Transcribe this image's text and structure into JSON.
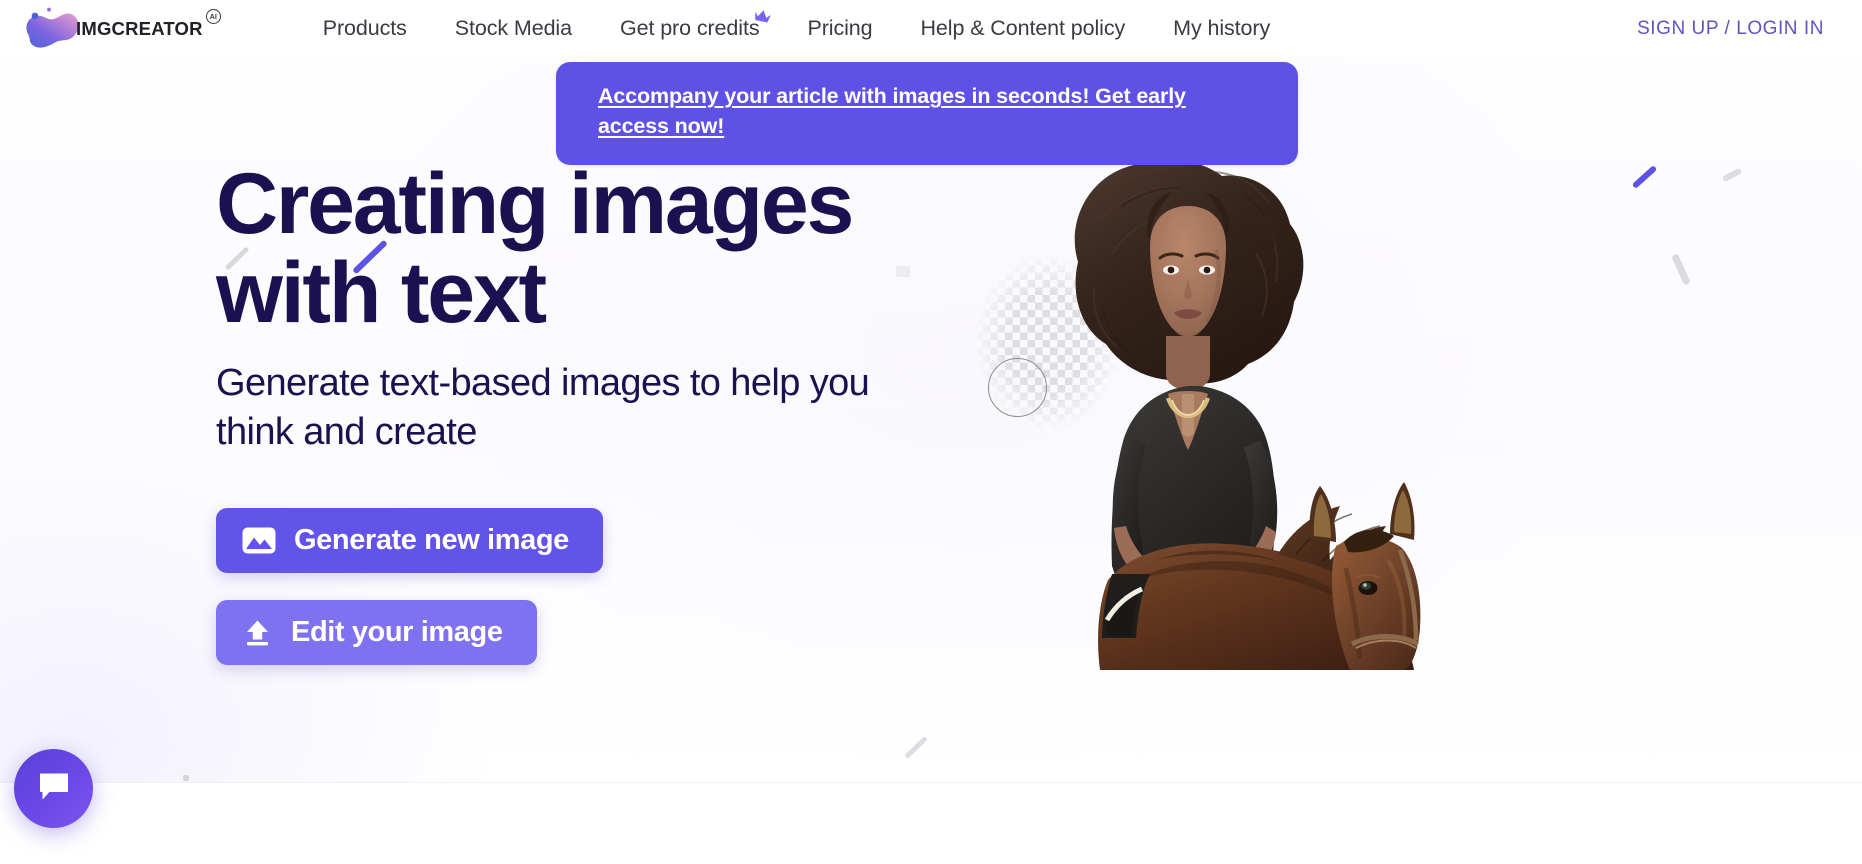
{
  "brand": {
    "name": "IMGCREATOR",
    "superscript": "AI",
    "logo_icon": "blob-gradient-logo",
    "gradient_from": "#4a63d8",
    "gradient_mid": "#8b5fd6",
    "gradient_to": "#e79ecf"
  },
  "nav": {
    "items": [
      {
        "label": "Products",
        "icon": null
      },
      {
        "label": "Stock Media",
        "icon": null
      },
      {
        "label": "Get pro credits",
        "icon": "crown-icon"
      },
      {
        "label": "Pricing",
        "icon": null
      },
      {
        "label": "Help & Content policy",
        "icon": null
      },
      {
        "label": "My history",
        "icon": null
      }
    ],
    "auth_label": "SIGN UP / LOGIN IN",
    "auth_color": "#6055c0"
  },
  "promo": {
    "text": "Accompany your article with images in seconds! Get early access now!",
    "background": "#5f51e6",
    "text_color": "#ffffff"
  },
  "hero": {
    "headline_line1": "Creating images",
    "headline_line2": "with text",
    "headline_color": "#1b1150",
    "subhead": "Generate text-based images to help you think and create",
    "primary_button": {
      "label": "Generate new image",
      "icon": "image-icon",
      "color": "#6254e8"
    },
    "secondary_button": {
      "label": "Edit your image",
      "icon": "upload-icon",
      "color": "#7e72f0"
    },
    "artwork": {
      "description": "Woman with afro hair riding a brown horse",
      "transparency_checker": "checkerboard-pattern",
      "circle_marker": "circle-outline"
    }
  },
  "widgets": {
    "chat": {
      "icon": "chat-bubble-icon",
      "color": "#6a48e6"
    }
  },
  "decorations": {
    "accent_dash_color": "#5f51e6",
    "neutral_dash_color": "#d8d8de",
    "square_color": "#ececf1"
  }
}
